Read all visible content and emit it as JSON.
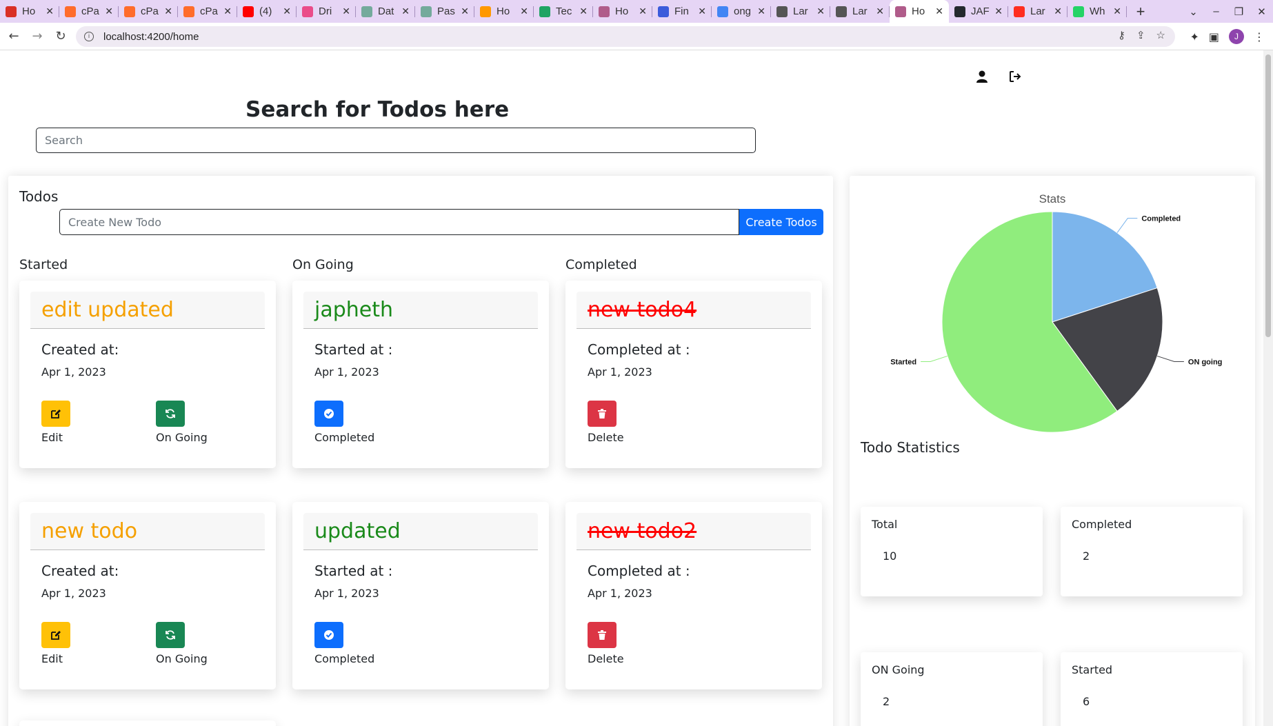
{
  "browser": {
    "tabs": [
      {
        "label": "Ho",
        "favicon": "gmail-icon",
        "color": "#d93025"
      },
      {
        "label": "cPa",
        "favicon": "cpanel-icon",
        "color": "#ff6c2c"
      },
      {
        "label": "cPa",
        "favicon": "cpanel-icon",
        "color": "#ff6c2c"
      },
      {
        "label": "cPa",
        "favicon": "cpanel-icon",
        "color": "#ff6c2c"
      },
      {
        "label": "(4)",
        "favicon": "youtube-icon",
        "color": "#ff0000"
      },
      {
        "label": "Dri",
        "favicon": "dribbble-icon",
        "color": "#ea4c89"
      },
      {
        "label": "Dat",
        "favicon": "chatgpt-icon",
        "color": "#74aa9c"
      },
      {
        "label": "Pas",
        "favicon": "chatgpt-icon",
        "color": "#74aa9c"
      },
      {
        "label": "Ho",
        "favicon": "bell-icon",
        "color": "#ff9800"
      },
      {
        "label": "Tec",
        "favicon": "drive-icon",
        "color": "#1fa463"
      },
      {
        "label": "Ho",
        "favicon": "app-icon",
        "color": "#b05c8a"
      },
      {
        "label": "Fin",
        "favicon": "flag-icon",
        "color": "#3b5bdb"
      },
      {
        "label": "ong",
        "favicon": "google-icon",
        "color": "#4285f4"
      },
      {
        "label": "Lar",
        "favicon": "globe-icon",
        "color": "#555555"
      },
      {
        "label": "Lar",
        "favicon": "globe-icon",
        "color": "#555555"
      },
      {
        "label": "Ho",
        "favicon": "app-icon",
        "color": "#b05c8a",
        "active": true
      },
      {
        "label": "JAF",
        "favicon": "github-icon",
        "color": "#24292e"
      },
      {
        "label": "Lar",
        "favicon": "laravel-icon",
        "color": "#ff2d20"
      },
      {
        "label": "Wh",
        "favicon": "whatsapp-icon",
        "color": "#25d366"
      }
    ],
    "url": "localhost:4200/home",
    "profile_initial": "J"
  },
  "search": {
    "title": "Search for Todos here",
    "placeholder": "Search"
  },
  "todos": {
    "heading": "Todos",
    "create_placeholder": "Create New Todo",
    "create_button": "Create Todos",
    "columns": [
      "Started",
      "On Going",
      "Completed"
    ],
    "started": [
      {
        "title": "edit updated",
        "label": "Created at:",
        "date": "Apr 1, 2023",
        "actions": [
          "Edit",
          "On Going"
        ]
      },
      {
        "title": "new todo",
        "label": "Created at:",
        "date": "Apr 1, 2023",
        "actions": [
          "Edit",
          "On Going"
        ]
      }
    ],
    "ongoing": [
      {
        "title": "japheth",
        "label": "Started at :",
        "date": "Apr 1, 2023",
        "actions": [
          "Completed"
        ]
      },
      {
        "title": "updated",
        "label": "Started at :",
        "date": "Apr 1, 2023",
        "actions": [
          "Completed"
        ]
      }
    ],
    "completed": [
      {
        "title": "new todo4",
        "label": "Completed at :",
        "date": "Apr 1, 2023",
        "actions": [
          "Delete"
        ]
      },
      {
        "title": "new todo2",
        "label": "Completed at :",
        "date": "Apr 1, 2023",
        "actions": [
          "Delete"
        ]
      }
    ]
  },
  "stats": {
    "title": "Stats",
    "section_heading": "Todo Statistics",
    "cards": [
      {
        "label": "Total",
        "value": "10"
      },
      {
        "label": "Completed",
        "value": "2"
      },
      {
        "label": "ON Going",
        "value": "2"
      },
      {
        "label": "Started",
        "value": "6"
      }
    ]
  },
  "chart_data": {
    "type": "pie",
    "title": "Stats",
    "slices": [
      {
        "label": "Completed",
        "value": 2,
        "color": "#7cb5ec"
      },
      {
        "label": "ON going",
        "value": 2,
        "color": "#434348"
      },
      {
        "label": "Started",
        "value": 6,
        "color": "#90ed7d"
      }
    ]
  },
  "colors": {
    "primary": "#0d6efd",
    "warning": "#ffc107",
    "success": "#198754",
    "danger": "#dc3545",
    "started_title": "#f5a000",
    "ongoing_title": "#1a8a1a",
    "completed_title": "#ff0000"
  }
}
